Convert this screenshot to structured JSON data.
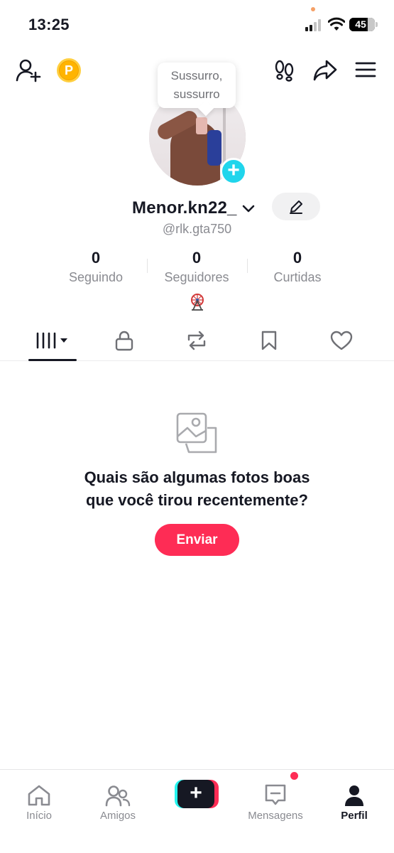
{
  "status_bar": {
    "time": "13:25",
    "battery": "45",
    "battery_level_percent": 45
  },
  "profile": {
    "bubble_text": "Sussurro,\nsussurro",
    "name": "Menor.kn22_",
    "handle": "@rlk.gta750"
  },
  "stats": [
    {
      "value": "0",
      "label": "Seguindo"
    },
    {
      "value": "0",
      "label": "Seguidores"
    },
    {
      "value": "0",
      "label": "Curtidas"
    }
  ],
  "tabs": [
    {
      "icon": "grid-videos-icon",
      "active": true
    },
    {
      "icon": "lock-icon",
      "active": false
    },
    {
      "icon": "repost-icon",
      "active": false
    },
    {
      "icon": "bookmark-icon",
      "active": false
    },
    {
      "icon": "heart-icon",
      "active": false
    }
  ],
  "empty_state": {
    "title_line1": "Quais são algumas fotos boas",
    "title_line2": "que você tirou recentemente?",
    "button_label": "Enviar"
  },
  "bottom_nav": [
    {
      "label": "Início",
      "icon": "home-icon",
      "active": false
    },
    {
      "label": "Amigos",
      "icon": "friends-icon",
      "active": false
    },
    {
      "label": "",
      "icon": "create-icon",
      "active": false
    },
    {
      "label": "Mensagens",
      "icon": "inbox-icon",
      "active": false
    },
    {
      "label": "Perfil",
      "icon": "profile-icon",
      "active": true
    }
  ],
  "colors": {
    "accent": "#fe2c55",
    "cyan": "#25f4ee",
    "coin": "#ffb400",
    "text": "#161823",
    "muted": "#8a8b91"
  }
}
